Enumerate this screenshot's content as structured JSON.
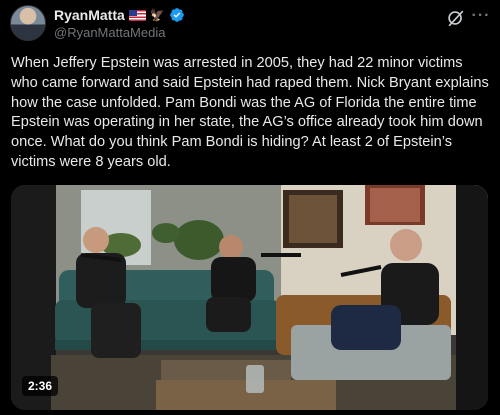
{
  "author": {
    "display_name": "RyanMatta",
    "handle": "@RyanMattaMedia",
    "flag_icon": "us-flag-icon",
    "eagle_icon": "eagle-emoji-icon",
    "verified_icon": "verified-badge-icon"
  },
  "actions": {
    "grok_icon": "grok-icon",
    "more_label": "···"
  },
  "tweet": {
    "text": "When Jeffery Epstein was arrested in 2005, they had 22 minor victims who came forward and said Epstein had raped them. Nick Bryant explains how the case unfolded. Pam Bondi was the AG of Florida the entire time Epstein was operating in her state, the AG’s office already took him down once. What do you think Pam Bondi is hiding? At least 2 of Epstein’s victims were 8 years old."
  },
  "video": {
    "duration": "2:36"
  },
  "colors": {
    "background": "#000000",
    "text": "#e7e9ea",
    "secondary_text": "#71767b",
    "verified_blue": "#1d9bf0"
  }
}
